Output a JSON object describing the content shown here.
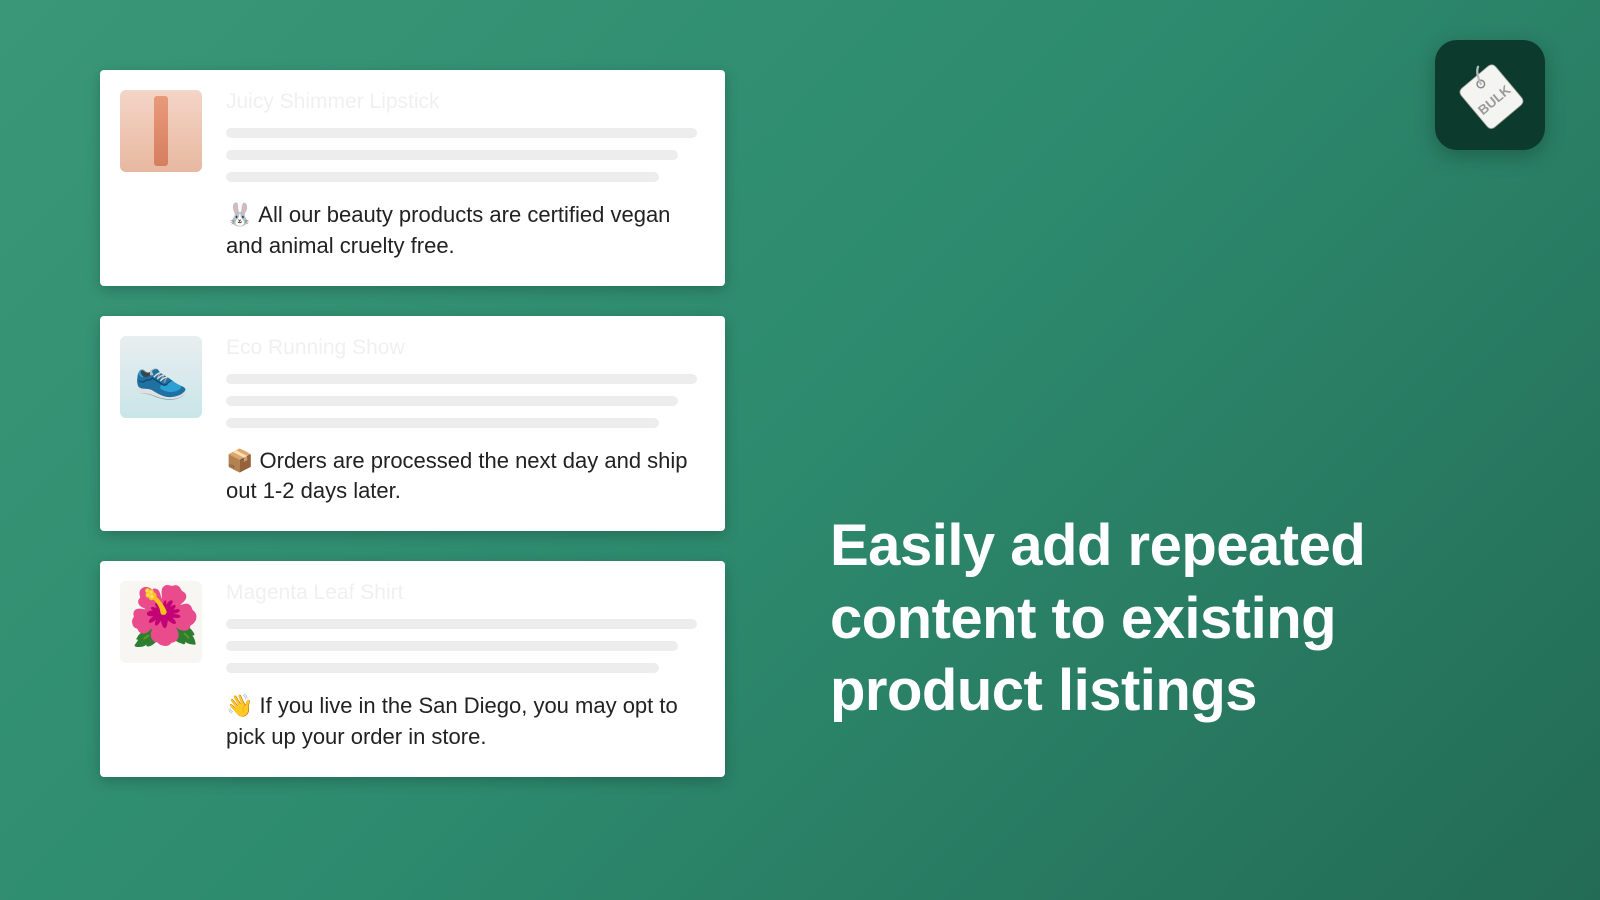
{
  "appIcon": {
    "label": "BULK"
  },
  "cards": [
    {
      "title": "Juicy Shimmer Lipstick",
      "note": "🐰 All our beauty products are certified vegan and animal cruelty free."
    },
    {
      "title": "Eco Running Show",
      "note": "📦 Orders are processed the next day and ship out 1-2 days later."
    },
    {
      "title": "Magenta Leaf Shirt",
      "note": "👋 If you live in the San Diego, you may opt to pick up your order in store."
    }
  ],
  "headline": "Easily add repeated content to existing product  listings"
}
